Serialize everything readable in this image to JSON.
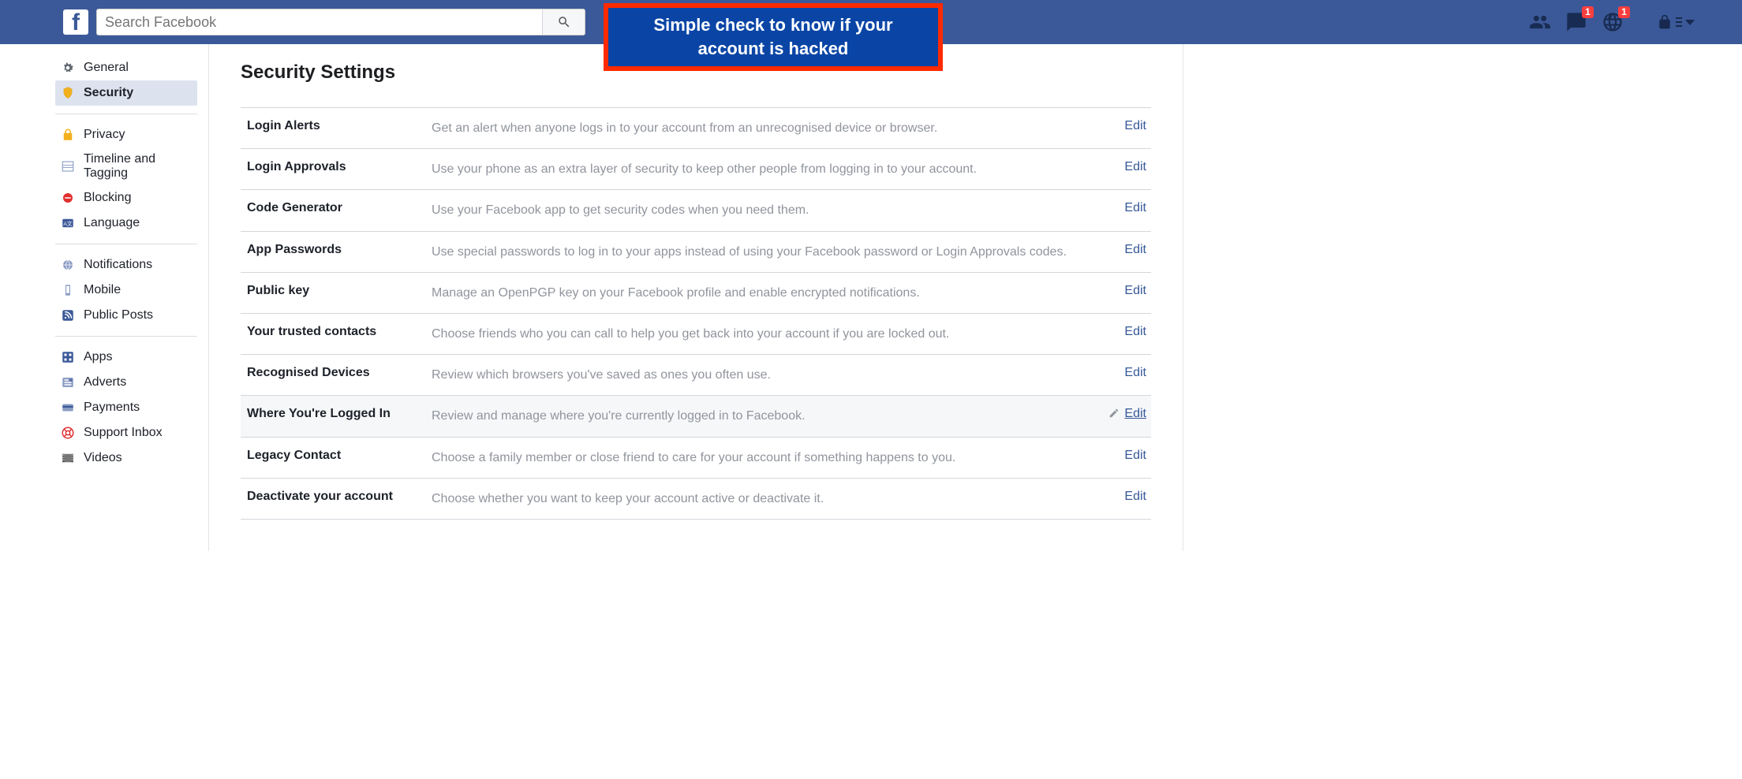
{
  "header": {
    "search_placeholder": "Search Facebook",
    "messages_badge": "1",
    "notifications_badge": "1"
  },
  "callout": {
    "text": "Simple check to know if your account is hacked"
  },
  "sidebar": {
    "groups": [
      [
        {
          "label": "General",
          "icon": "gear",
          "selected": false
        },
        {
          "label": "Security",
          "icon": "shield",
          "selected": true
        }
      ],
      [
        {
          "label": "Privacy",
          "icon": "lock"
        },
        {
          "label": "Timeline and Tagging",
          "icon": "timeline"
        },
        {
          "label": "Blocking",
          "icon": "blocking"
        },
        {
          "label": "Language",
          "icon": "language"
        }
      ],
      [
        {
          "label": "Notifications",
          "icon": "globe"
        },
        {
          "label": "Mobile",
          "icon": "mobile"
        },
        {
          "label": "Public Posts",
          "icon": "rss"
        }
      ],
      [
        {
          "label": "Apps",
          "icon": "apps"
        },
        {
          "label": "Adverts",
          "icon": "adverts"
        },
        {
          "label": "Payments",
          "icon": "payments"
        },
        {
          "label": "Support Inbox",
          "icon": "support"
        },
        {
          "label": "Videos",
          "icon": "videos"
        }
      ]
    ]
  },
  "main": {
    "title": "Security Settings",
    "edit_label": "Edit",
    "rows": [
      {
        "label": "Login Alerts",
        "desc": "Get an alert when anyone logs in to your account from an unrecognised device or browser.",
        "highlight": false,
        "pencil": false
      },
      {
        "label": "Login Approvals",
        "desc": "Use your phone as an extra layer of security to keep other people from logging in to your account.",
        "highlight": false,
        "pencil": false
      },
      {
        "label": "Code Generator",
        "desc": "Use your Facebook app to get security codes when you need them.",
        "highlight": false,
        "pencil": false
      },
      {
        "label": "App Passwords",
        "desc": "Use special passwords to log in to your apps instead of using your Facebook password or Login Approvals codes.",
        "highlight": false,
        "pencil": false
      },
      {
        "label": "Public key",
        "desc": "Manage an OpenPGP key on your Facebook profile and enable encrypted notifications.",
        "highlight": false,
        "pencil": false
      },
      {
        "label": "Your trusted contacts",
        "desc": "Choose friends who you can call to help you get back into your account if you are locked out.",
        "highlight": false,
        "pencil": false
      },
      {
        "label": "Recognised Devices",
        "desc": "Review which browsers you've saved as ones you often use.",
        "highlight": false,
        "pencil": false
      },
      {
        "label": "Where You're Logged In",
        "desc": "Review and manage where you're currently logged in to Facebook.",
        "highlight": true,
        "pencil": true
      },
      {
        "label": "Legacy Contact",
        "desc": "Choose a family member or close friend to care for your account if something happens to you.",
        "highlight": false,
        "pencil": false
      },
      {
        "label": "Deactivate your account",
        "desc": "Choose whether you want to keep your account active or deactivate it.",
        "highlight": false,
        "pencil": false
      }
    ]
  }
}
